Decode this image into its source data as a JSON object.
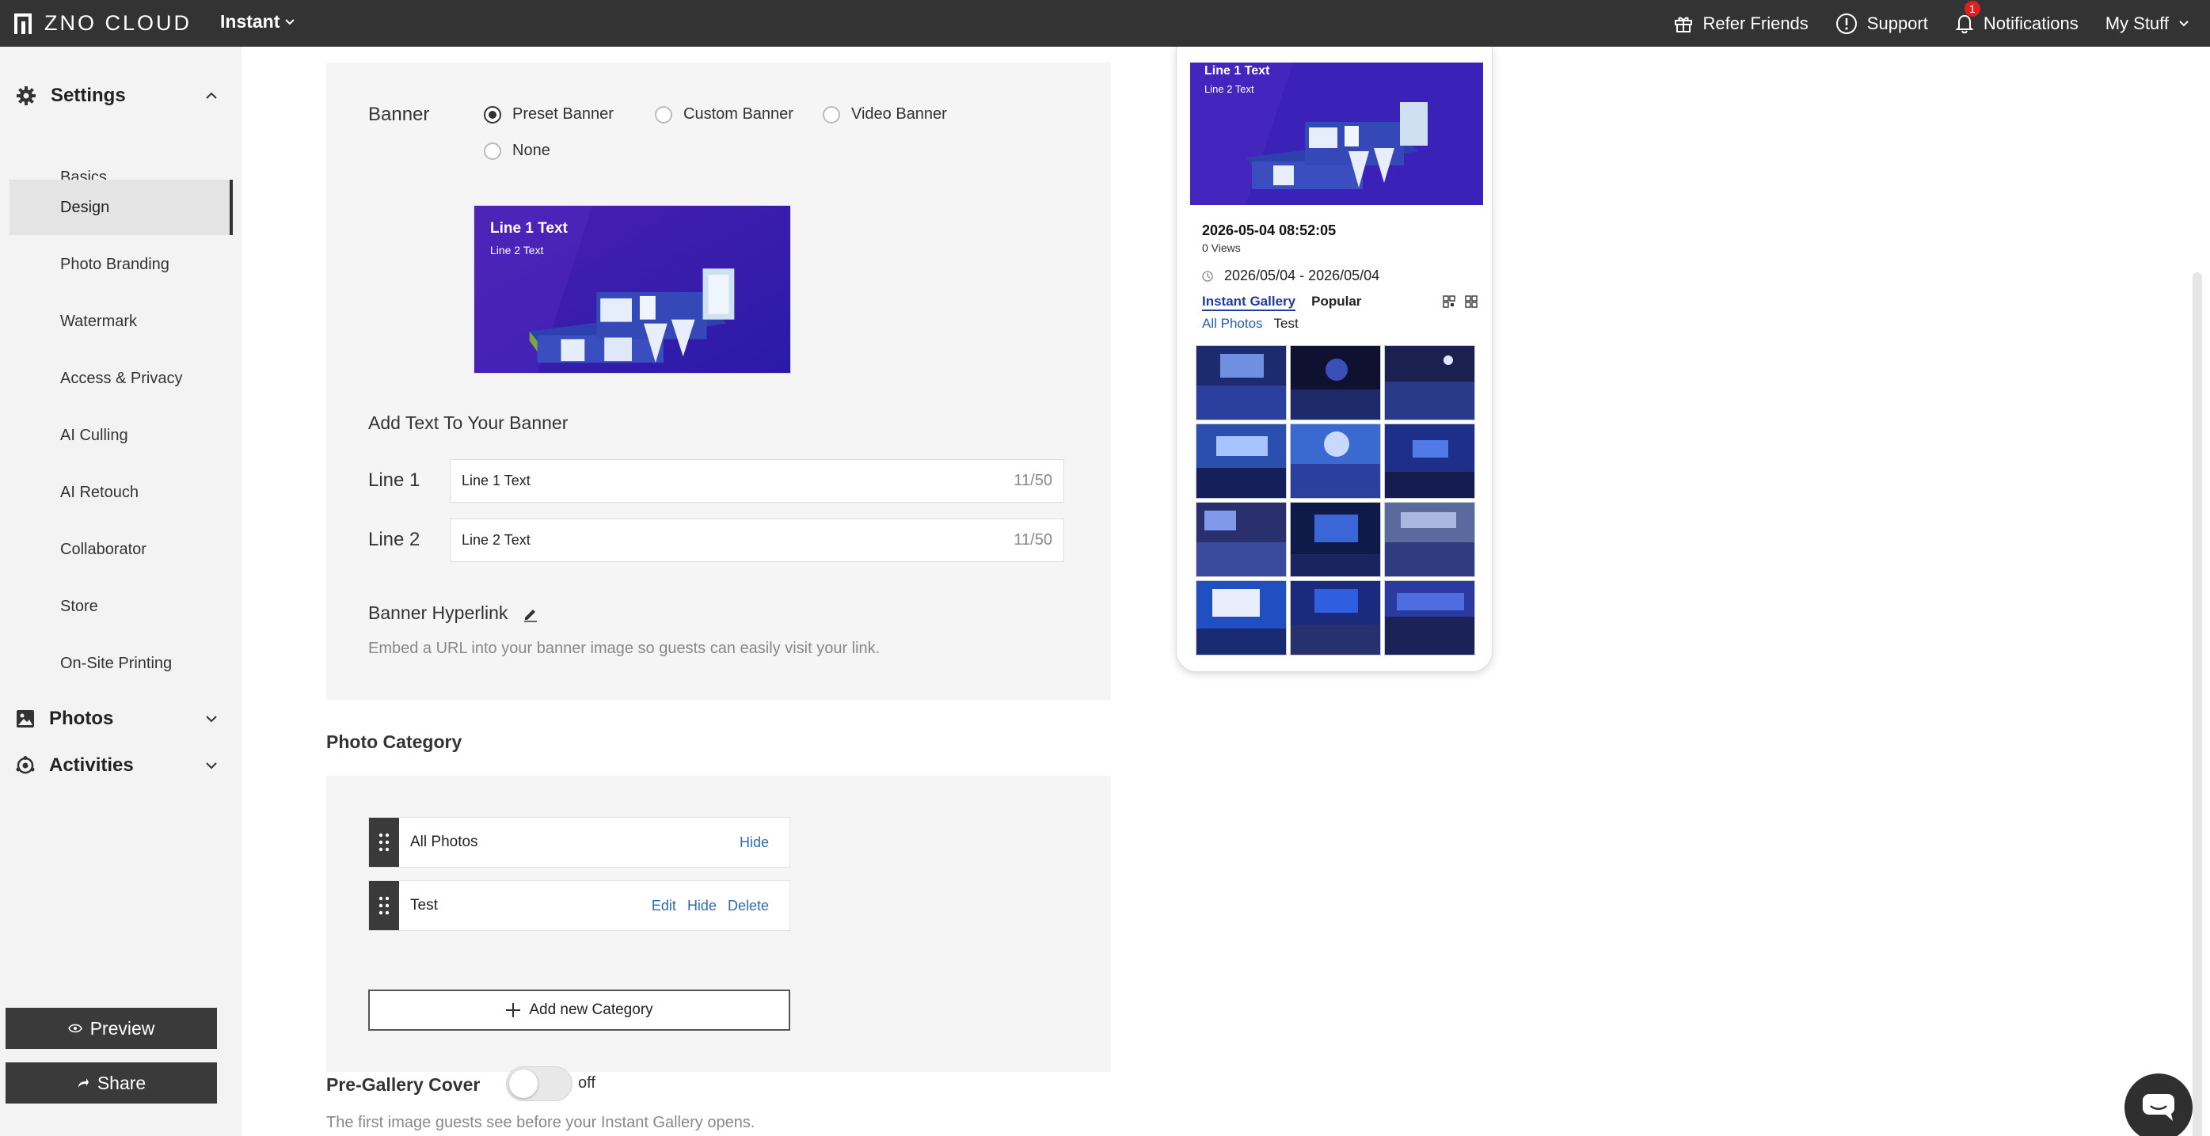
{
  "topbar": {
    "logo_text": "ZNO CLOUD",
    "plan_label": "Instant",
    "refer_label": "Refer Friends",
    "support_label": "Support",
    "notifications_label": "Notifications",
    "notifications_count": "1",
    "my_stuff_label": "My Stuff"
  },
  "sidebar": {
    "settings_label": "Settings",
    "items": [
      {
        "label": "Basics"
      },
      {
        "label": "Design"
      },
      {
        "label": "Photo Branding"
      },
      {
        "label": "Watermark"
      },
      {
        "label": "Access & Privacy"
      },
      {
        "label": "AI Culling"
      },
      {
        "label": "AI Retouch"
      },
      {
        "label": "Collaborator"
      },
      {
        "label": "Store"
      },
      {
        "label": "On-Site Printing"
      }
    ],
    "active_item": "Design",
    "photos_label": "Photos",
    "activities_label": "Activities",
    "preview_label": "Preview",
    "share_label": "Share"
  },
  "banner": {
    "label": "Banner",
    "options": [
      "Preset Banner",
      "Custom Banner",
      "Video Banner",
      "None"
    ],
    "selected": "Preset Banner",
    "preview_line1": "Line 1 Text",
    "preview_line2": "Line 2 Text",
    "add_text_title": "Add Text To Your Banner",
    "line1_label": "Line 1",
    "line1_value": "Line 1 Text",
    "line1_counter": "11/50",
    "line2_label": "Line 2",
    "line2_value": "Line 2 Text",
    "line2_counter": "11/50",
    "hyperlink_label": "Banner Hyperlink",
    "hyperlink_desc": "Embed a URL into your banner image so guests can easily visit your link."
  },
  "photo_category": {
    "title": "Photo Category",
    "rows": [
      {
        "name": "All Photos",
        "actions": [
          "Hide"
        ]
      },
      {
        "name": "Test",
        "actions": [
          "Edit",
          "Hide",
          "Delete"
        ]
      }
    ],
    "add_label": "Add new Category"
  },
  "pre_gallery": {
    "title": "Pre-Gallery Cover",
    "toggle_state": "off",
    "desc": "The first image guests see before your Instant Gallery opens."
  },
  "phone": {
    "banner_line1": "Line 1 Text",
    "banner_line2": "Line 2 Text",
    "date": "2026-05-04 08:52:05",
    "views": "0 Views",
    "range": "2026/05/04 - 2026/05/04",
    "tab_active": "Instant Gallery",
    "tab_other": "Popular",
    "cat_active": "All Photos",
    "cat_other": "Test"
  },
  "colors": {
    "topbar": "#333333",
    "banner_purple": "#3a1fb8",
    "link_blue": "#2b6cb0"
  }
}
